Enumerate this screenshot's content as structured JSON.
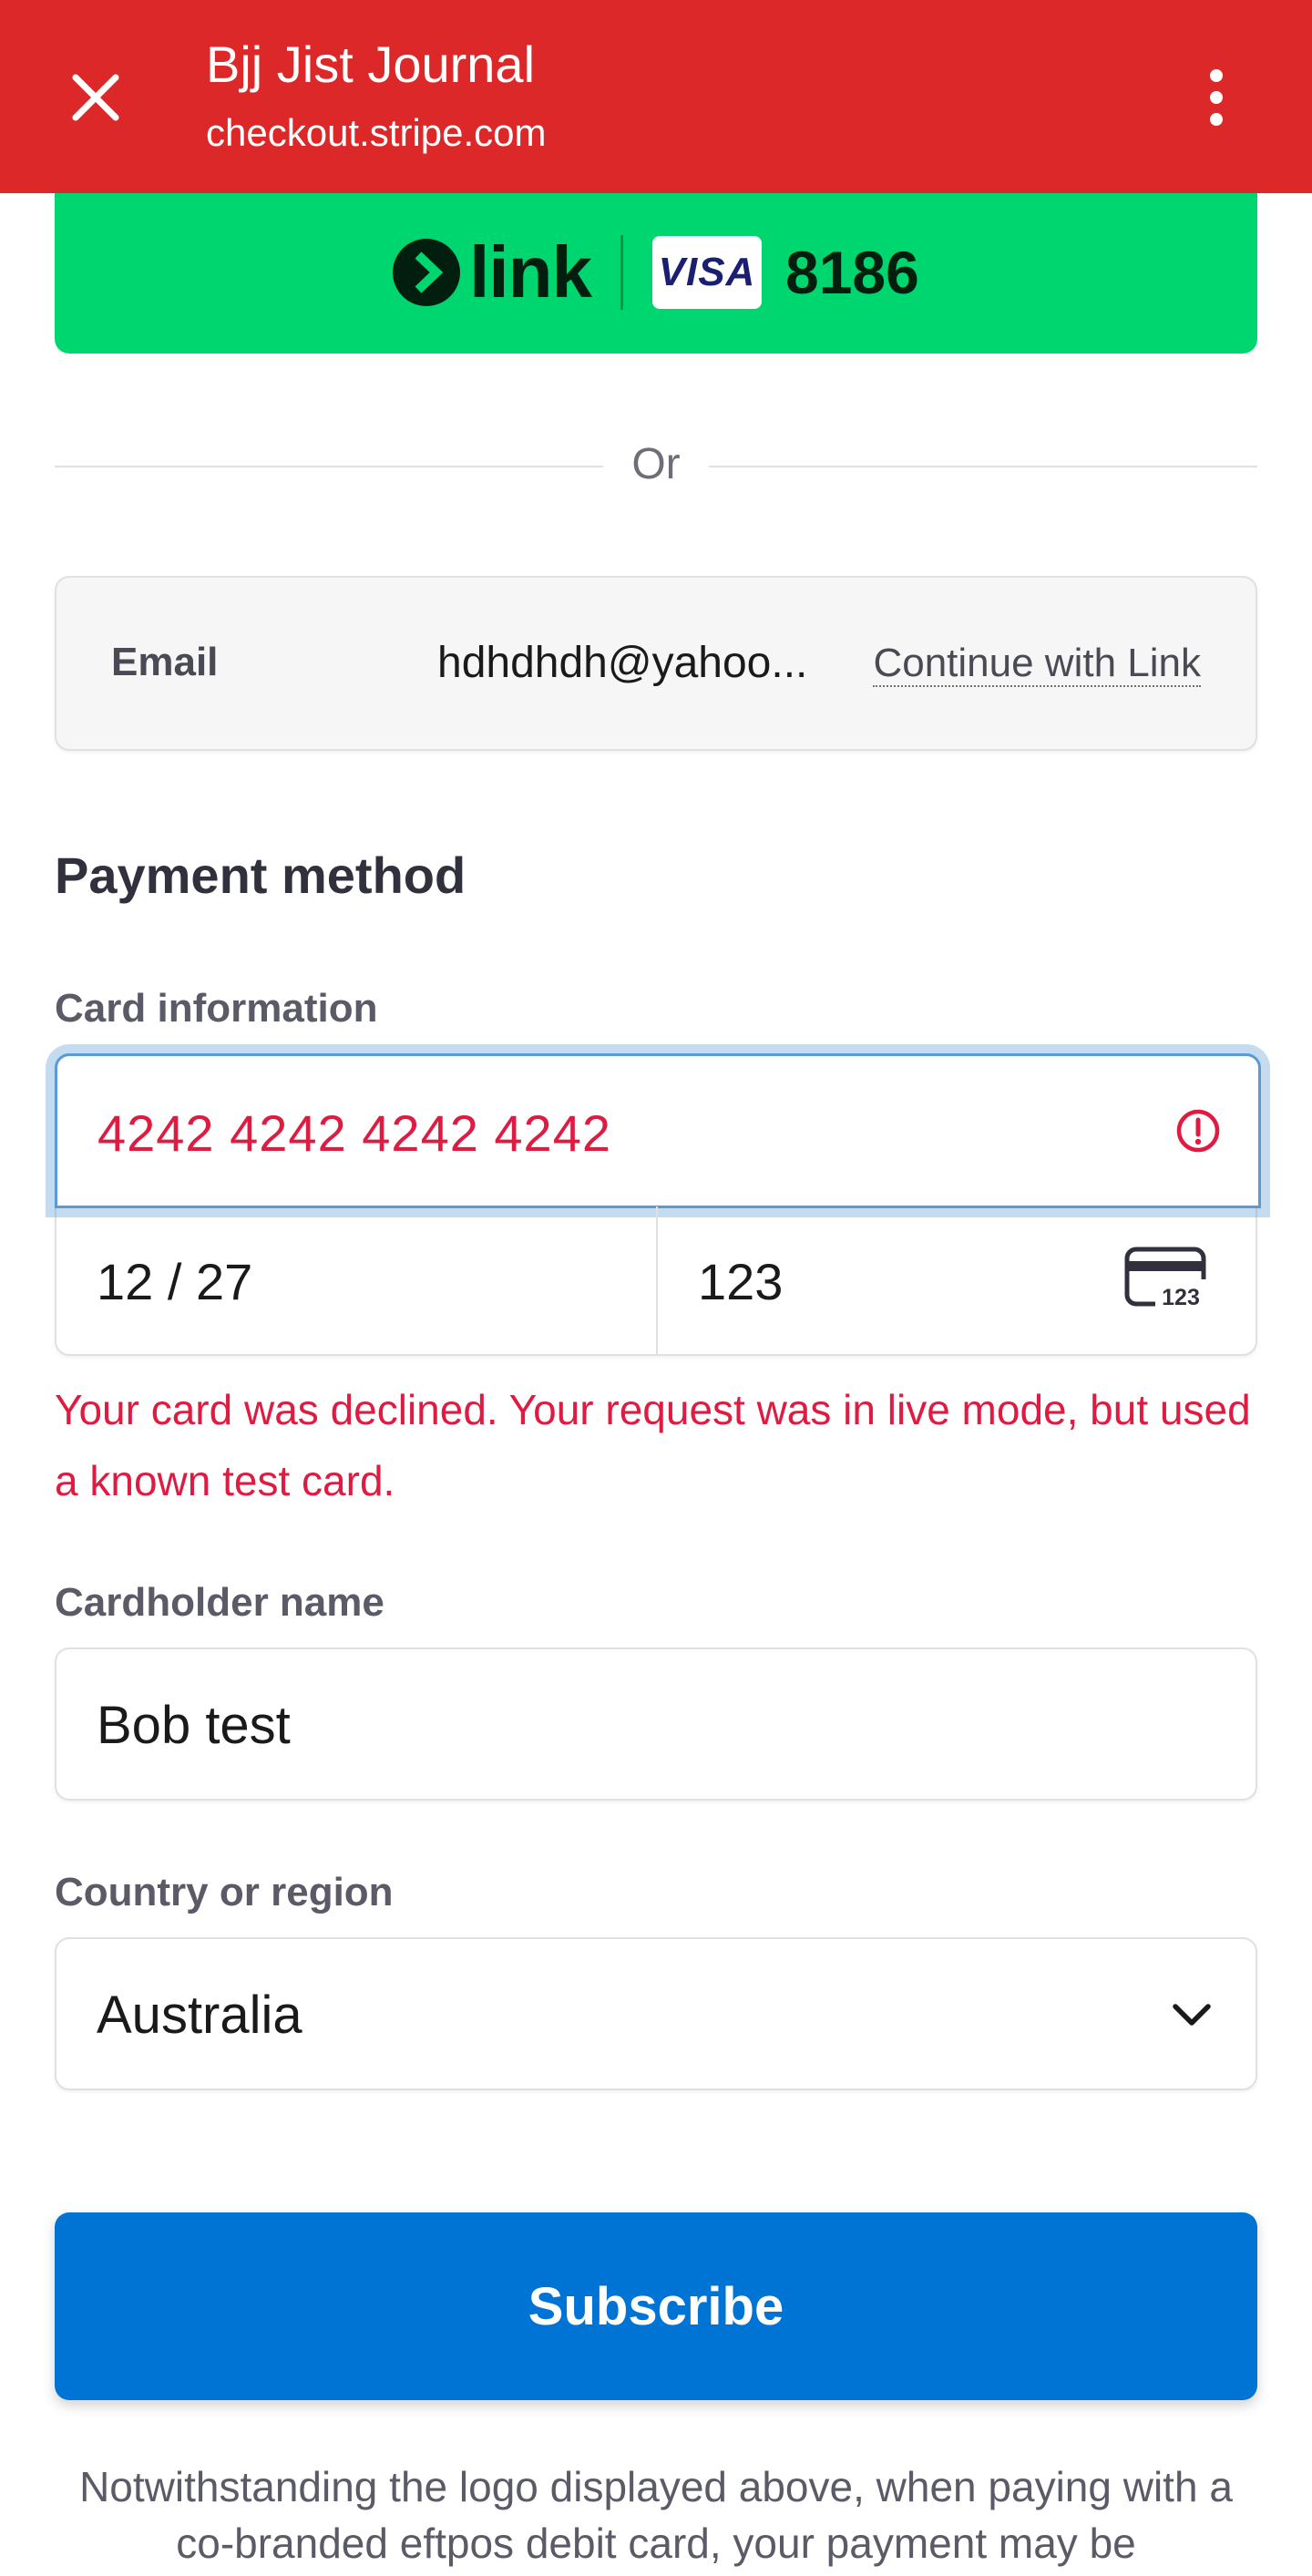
{
  "header": {
    "title": "Bjj Jist Journal",
    "url": "checkout.stripe.com",
    "close_icon": "close-icon",
    "menu_icon": "more-vertical-icon",
    "background_color": "#dc2828"
  },
  "link_button": {
    "logo_text": "link",
    "card_brand": "VISA",
    "last4": "8186",
    "background_color": "#00d66f"
  },
  "divider": {
    "text": "Or"
  },
  "email": {
    "label": "Email",
    "value": "hdhdhdh@yahoo...",
    "link_text": "Continue with Link"
  },
  "payment": {
    "section_title": "Payment method",
    "card_label": "Card information",
    "card_number": "4242 4242 4242 4242",
    "expiry": "12 / 27",
    "cvc": "123",
    "cvc_icon_text": "123",
    "error_icon": "alert-circle-icon",
    "error_message": "Your card was declined. Your request was in live mode, but used a known test card.",
    "error_color": "#df1b41"
  },
  "cardholder": {
    "label": "Cardholder name",
    "value": "Bob test"
  },
  "country": {
    "label": "Country or region",
    "value": "Australia",
    "chevron_icon": "chevron-down-icon"
  },
  "subscribe": {
    "label": "Subscribe",
    "color": "#0074d4"
  },
  "footnote": "Notwithstanding the logo displayed above, when paying with a co-branded eftpos debit card, your payment may be"
}
